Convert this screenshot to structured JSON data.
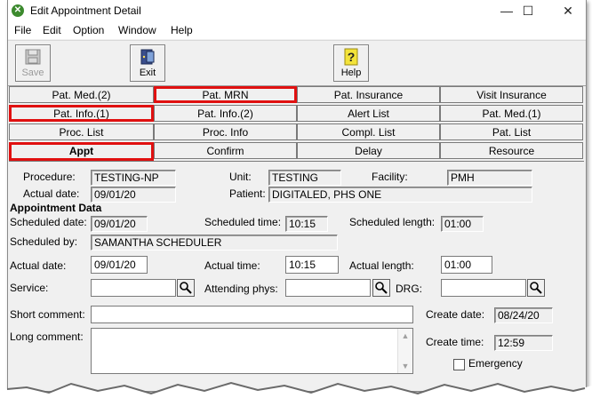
{
  "window": {
    "title": "Edit Appointment Detail",
    "minimize": "—",
    "maximize": "☐",
    "close": "✕"
  },
  "menu": [
    "File",
    "Edit",
    "Option",
    "Window",
    "Help"
  ],
  "toolbar": {
    "save_label": "Save",
    "exit_label": "Exit",
    "help_label": "Help"
  },
  "tabs": {
    "row1": [
      "Pat. Med.(2)",
      "Pat. MRN",
      "Pat. Insurance",
      "Visit Insurance"
    ],
    "row2": [
      "Pat. Info.(1)",
      "Pat. Info.(2)",
      "Alert List",
      "Pat. Med.(1)"
    ],
    "row3": [
      "Proc. List",
      "Proc. Info",
      "Compl. List",
      "Pat. List"
    ],
    "row4": [
      "Appt",
      "Confirm",
      "Delay",
      "Resource"
    ]
  },
  "header": {
    "procedure_label": "Procedure:",
    "procedure": "TESTING-NP",
    "unit_label": "Unit:",
    "unit": "TESTING",
    "facility_label": "Facility:",
    "facility": "PMH",
    "actual_date_label": "Actual date:",
    "actual_date": "09/01/20",
    "patient_label": "Patient:",
    "patient": "DIGITALED, PHS ONE"
  },
  "appt": {
    "section_title": "Appointment Data",
    "sched_date_label": "Scheduled date:",
    "sched_date": "09/01/20",
    "sched_time_label": "Scheduled time:",
    "sched_time": "10:15",
    "sched_length_label": "Scheduled length:",
    "sched_length": "01:00",
    "sched_by_label": "Scheduled by:",
    "sched_by": "SAMANTHA SCHEDULER",
    "actual_date_label": "Actual date:",
    "actual_date": "09/01/20",
    "actual_time_label": "Actual time:",
    "actual_time": "10:15",
    "actual_length_label": "Actual length:",
    "actual_length": "01:00",
    "service_label": "Service:",
    "service": "",
    "attending_label": "Attending phys:",
    "attending": "",
    "drg_label": "DRG:",
    "drg": "",
    "short_comment_label": "Short comment:",
    "short_comment": "",
    "long_comment_label": "Long comment:",
    "create_date_label": "Create date:",
    "create_date": "08/24/20",
    "create_time_label": "Create time:",
    "create_time": "12:59",
    "emergency_label": "Emergency"
  },
  "colors": {
    "highlight": "#e01010",
    "window_bg": "#f0f0f0"
  }
}
